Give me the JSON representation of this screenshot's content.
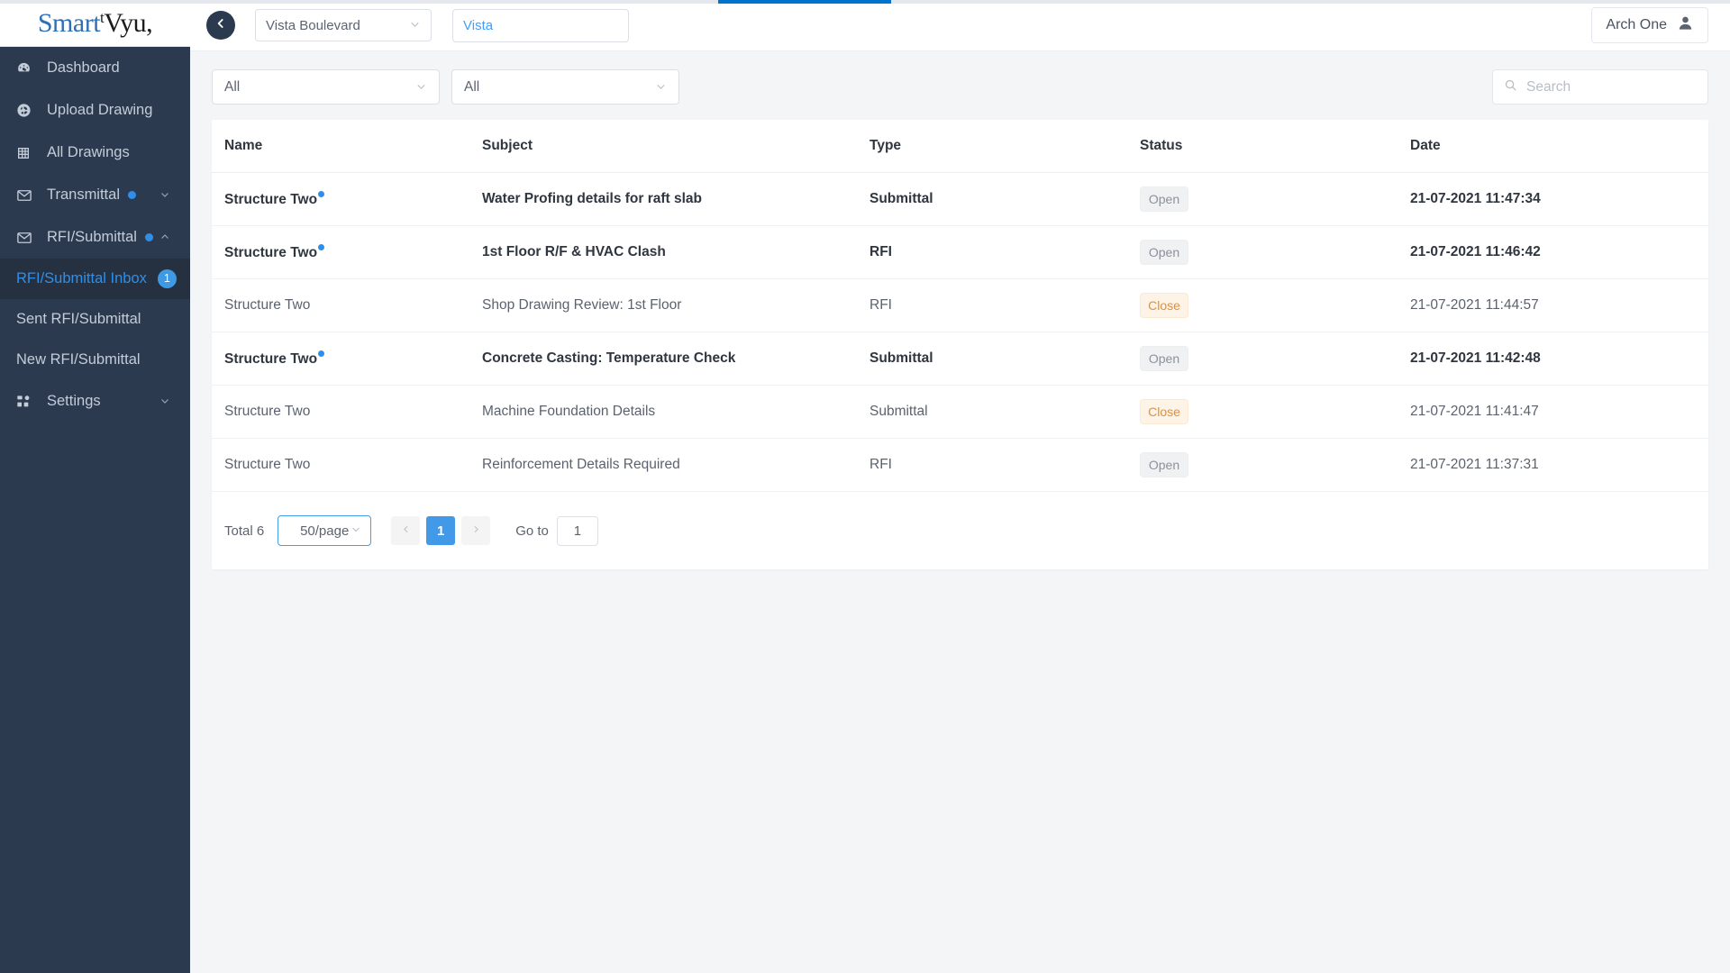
{
  "brand": {
    "name_first": "Smart",
    "name_tick": "t",
    "name_second": "Vyu",
    "name_comma": ","
  },
  "sidebar": {
    "items": [
      {
        "label": "Dashboard",
        "icon": "dashboard-icon"
      },
      {
        "label": "Upload Drawing",
        "icon": "upload-icon"
      },
      {
        "label": "All Drawings",
        "icon": "grid-icon"
      },
      {
        "label": "Transmittal",
        "icon": "envelope-icon",
        "dot": true,
        "caret": "chevron-down"
      },
      {
        "label": "RFI/Submittal",
        "icon": "envelope-icon",
        "dot": true,
        "caret": "chevron-up"
      }
    ],
    "sub_items": [
      {
        "label": "RFI/Submittal Inbox",
        "badge": "1",
        "active": true
      },
      {
        "label": "Sent RFI/Submittal",
        "badge": "",
        "active": false
      },
      {
        "label": "New RFI/Submittal",
        "badge": "",
        "active": false
      }
    ],
    "settings": {
      "label": "Settings",
      "icon": "apps-icon",
      "caret": "chevron-down"
    }
  },
  "header": {
    "collapse_icon": "chevron-left-icon",
    "project_select": "Vista Boulevard",
    "search_value": "",
    "search_placeholder": "Vista",
    "user_name": "Arch One",
    "user_icon": "user-icon"
  },
  "filters": {
    "type_filter": "All",
    "status_filter": "All",
    "search_placeholder": "Search",
    "search_value": "",
    "search_icon": "search-icon"
  },
  "table": {
    "columns": [
      "Name",
      "Subject",
      "Type",
      "Status",
      "Date"
    ],
    "rows": [
      {
        "name": "Structure Two",
        "unread": true,
        "subject": "Water Profing details for raft slab",
        "type": "Submittal",
        "status": "Open",
        "status_kind": "open",
        "date": "21-07-2021 11:47:34"
      },
      {
        "name": "Structure Two",
        "unread": true,
        "subject": "1st Floor R/F & HVAC Clash",
        "type": "RFI",
        "status": "Open",
        "status_kind": "open",
        "date": "21-07-2021 11:46:42"
      },
      {
        "name": "Structure Two",
        "unread": false,
        "subject": "Shop Drawing Review: 1st Floor",
        "type": "RFI",
        "status": "Close",
        "status_kind": "close",
        "date": "21-07-2021 11:44:57"
      },
      {
        "name": "Structure Two",
        "unread": true,
        "subject": "Concrete Casting: Temperature Check",
        "type": "Submittal",
        "status": "Open",
        "status_kind": "open",
        "date": "21-07-2021 11:42:48"
      },
      {
        "name": "Structure Two",
        "unread": false,
        "subject": "Machine Foundation Details",
        "type": "Submittal",
        "status": "Close",
        "status_kind": "close",
        "date": "21-07-2021 11:41:47"
      },
      {
        "name": "Structure Two",
        "unread": false,
        "subject": "Reinforcement Details Required",
        "type": "RFI",
        "status": "Open",
        "status_kind": "open",
        "date": "21-07-2021 11:37:31"
      }
    ]
  },
  "pagination": {
    "total_label": "Total 6",
    "page_size": "50/page",
    "prev_icon": "chevron-left-icon",
    "next_icon": "chevron-right-icon",
    "current_page": "1",
    "goto_label": "Go to",
    "goto_value": "1"
  },
  "colors": {
    "sidebar_bg": "#2c3a4f",
    "accent_blue": "#2f8fe8",
    "primary_blue": "#4199e8",
    "status_open_text": "#8b919b",
    "status_close_text": "#e0913b",
    "loading_bar": "#0073cf"
  }
}
